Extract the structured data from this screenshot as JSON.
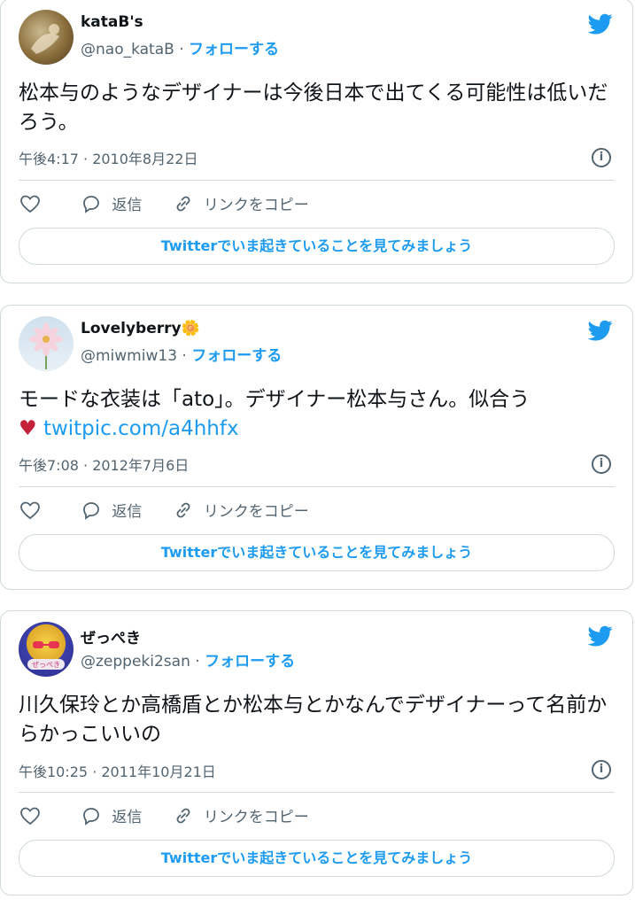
{
  "tweets": [
    {
      "name": "kataB's",
      "handle": "@nao_kataB",
      "follow_label": "フォローする",
      "text": "松本与のようなデザイナーは今後日本で出てくる可能性は低いだろう。",
      "link": "",
      "timestamp": "午後4:17 · 2010年8月22日",
      "reply_label": "返信",
      "copy_link_label": "リンクをコピー",
      "cta_label": "Twitterでいま起きていることを見てみましょう"
    },
    {
      "name": "Lovelyberry",
      "name_emoji": "🌼",
      "handle": "@miwmiw13",
      "follow_label": "フォローする",
      "text": "モードな衣装は「ato」。デザイナー松本与さん。似合う",
      "emoji": "♥",
      "link": "twitpic.com/a4hhfx",
      "timestamp": "午後7:08 · 2012年7月6日",
      "reply_label": "返信",
      "copy_link_label": "リンクをコピー",
      "cta_label": "Twitterでいま起きていることを見てみましょう"
    },
    {
      "name": "ぜっぺき",
      "handle": "@zeppeki2san",
      "follow_label": "フォローする",
      "text": "川久保玲とか高橋盾とか松本与とかなんでデザイナーって名前からかっこいいの",
      "link": "",
      "timestamp": "午後10:25 · 2011年10月21日",
      "reply_label": "返信",
      "copy_link_label": "リンクをコピー",
      "cta_label": "Twitterでいま起きていることを見てみましょう"
    }
  ],
  "colors": {
    "accent": "#1d9bf0",
    "muted": "#536471",
    "border": "#cfd9de"
  },
  "icons": [
    "twitter-bird-icon",
    "heart-icon",
    "reply-icon",
    "link-icon",
    "info-icon"
  ]
}
